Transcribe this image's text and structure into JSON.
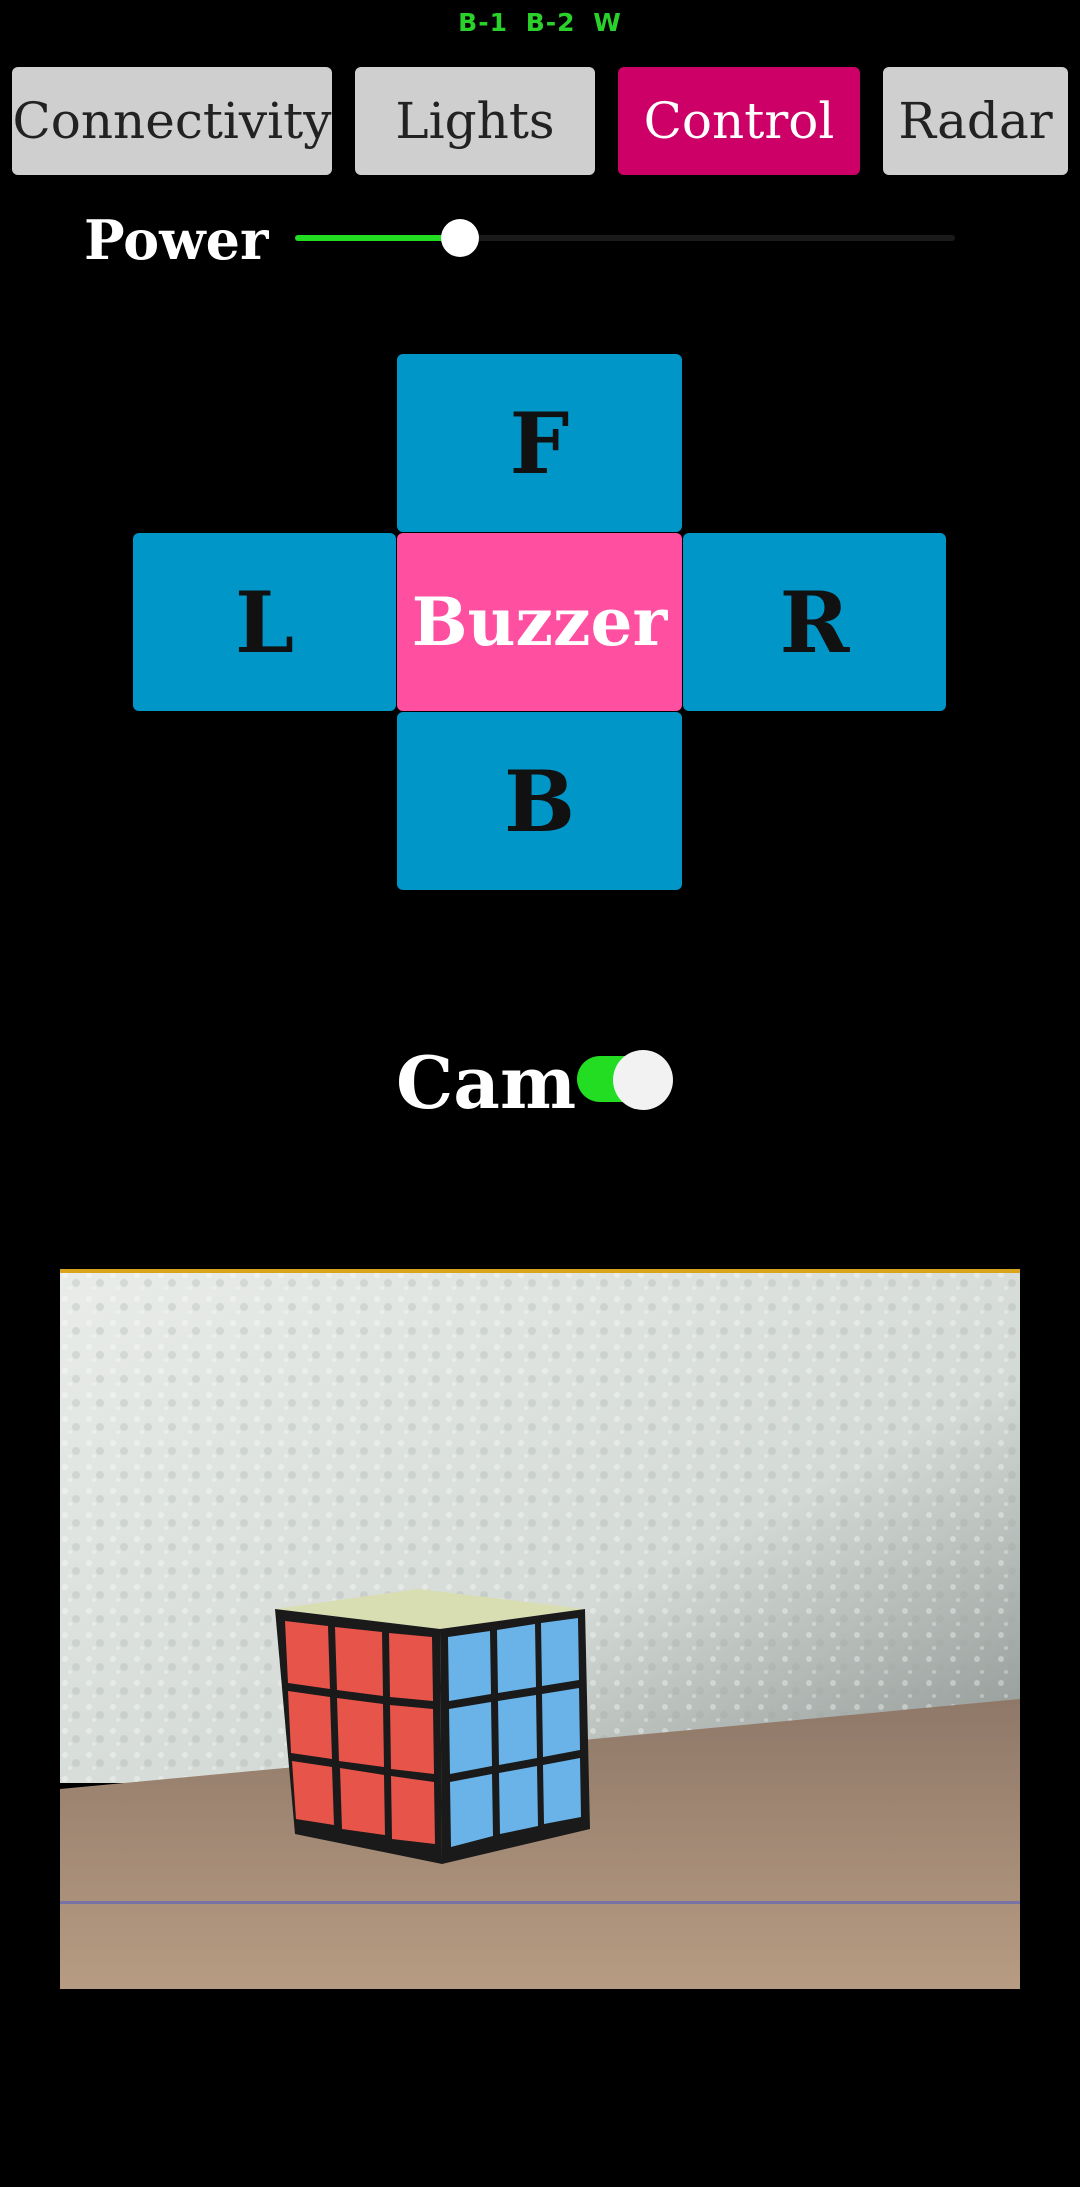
{
  "status": {
    "b1": "B-1",
    "b2": "B-2",
    "w": "W",
    "color": "#2bd12b"
  },
  "tabs": [
    {
      "label": "Connectivity",
      "active": false
    },
    {
      "label": "Lights",
      "active": false
    },
    {
      "label": "Control",
      "active": true
    },
    {
      "label": "Radar",
      "active": false
    }
  ],
  "colors": {
    "tab_active": "#cc0066",
    "tab_inactive": "#cfcfcf",
    "dpad": "#0096c8",
    "buzzer": "#ff4fa0",
    "accent_green": "#22dd22"
  },
  "power": {
    "label": "Power",
    "value_fraction": 0.25
  },
  "dpad": {
    "forward": "F",
    "left": "L",
    "right": "R",
    "back": "B",
    "buzzer": "Buzzer"
  },
  "camera": {
    "label": "Cam",
    "enabled": true,
    "feed_subject": "rubiks-cube-photo"
  }
}
